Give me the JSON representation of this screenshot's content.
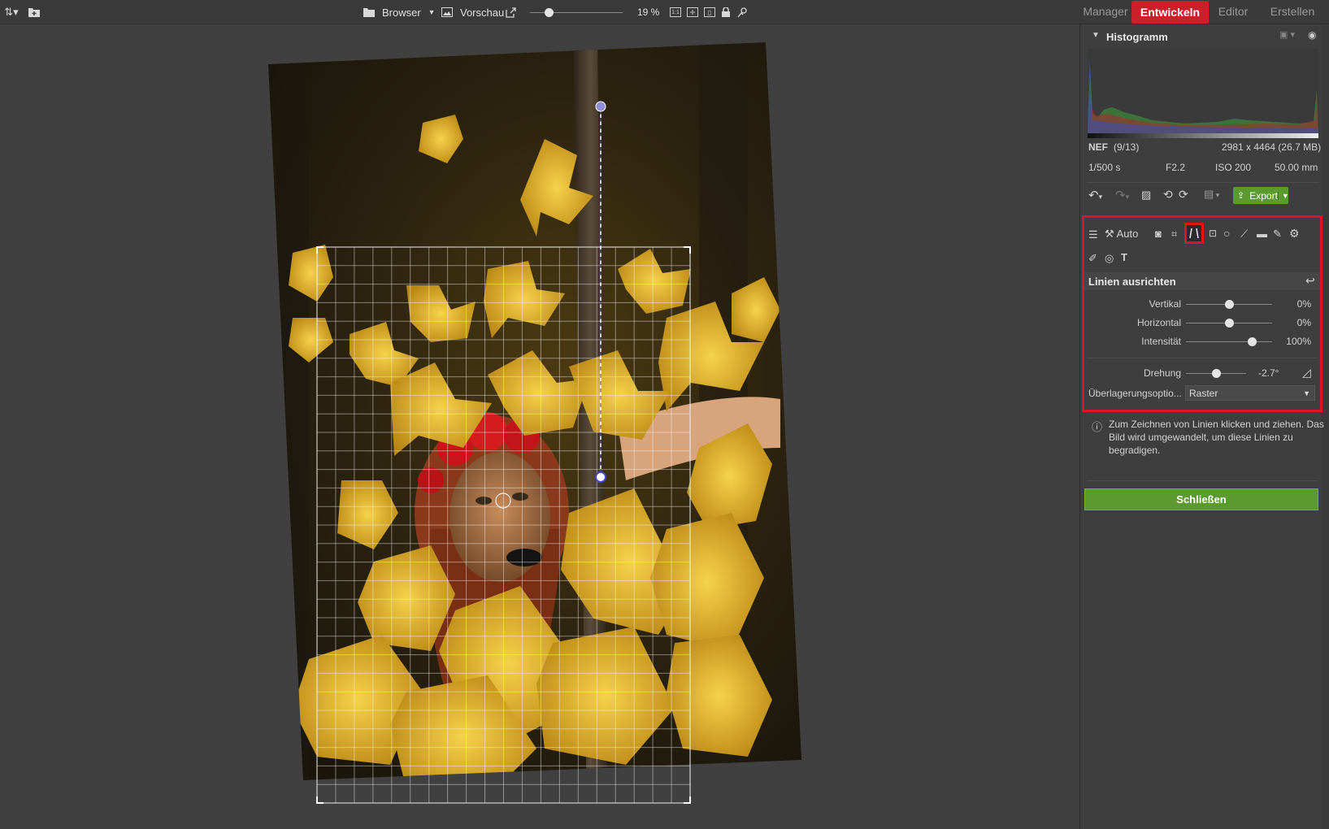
{
  "topbar": {
    "sort_icon": "sort-icon",
    "folder_icon": "folder-add-icon",
    "browser_label": "Browser",
    "preview_label": "Vorschau",
    "zoom_label": "19 %",
    "zoom_value": 0.19
  },
  "tabs": [
    {
      "label": "Manager",
      "active": false
    },
    {
      "label": "Entwickeln",
      "active": true
    },
    {
      "label": "Editor",
      "active": false
    },
    {
      "label": "Erstellen",
      "active": false
    }
  ],
  "histogram": {
    "title": "Histogramm",
    "format": "NEF",
    "index": "(9/13)",
    "dimensions": "2981 x 4464 (26.7 MB)",
    "shutter": "1/500 s",
    "aperture": "F2.2",
    "iso": "ISO 200",
    "focal": "50.00 mm"
  },
  "toolbar": {
    "export_label": "Export",
    "auto_label": "Auto"
  },
  "tool_panel": {
    "title": "Linien ausrichten",
    "sliders": [
      {
        "label": "Vertikal",
        "value_text": "0%",
        "fraction": 0.5
      },
      {
        "label": "Horizontal",
        "value_text": "0%",
        "fraction": 0.5
      },
      {
        "label": "Intensität",
        "value_text": "100%",
        "fraction": 0.76
      }
    ],
    "rotation": {
      "label": "Drehung",
      "value_text": "-2.7°",
      "fraction": 0.5
    },
    "overlay": {
      "label": "Überlagerungsoptio...",
      "value": "Raster"
    }
  },
  "info": {
    "text_line1": "Zum Zeichnen von Linien klicken und ziehen. Das",
    "text_line2": "Bild wird umgewandelt, um diese Linien zu",
    "text_line3": "begradigen."
  },
  "close_button": {
    "label": "Schließen"
  },
  "colors": {
    "accent_red": "#c9212a",
    "accent_green": "#5a9a2e",
    "highlight_red": "#e0141c"
  }
}
